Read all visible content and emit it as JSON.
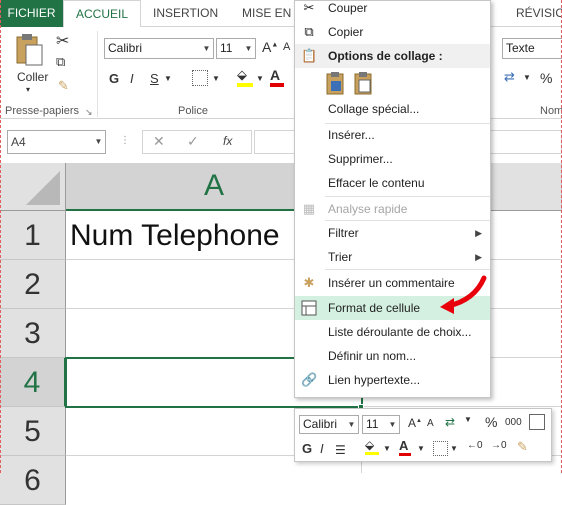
{
  "tabs": {
    "fichier": "FICHIER",
    "accueil": "ACCUEIL",
    "insertion": "INSERTION",
    "mise_en_page": "MISE EN P",
    "revision": "RÉVISION"
  },
  "ribbon": {
    "paste_label": "Coller",
    "clipboard_group": "Presse-papiers",
    "font_group": "Police",
    "number_group": "Nom",
    "font_name": "Calibri",
    "font_size": "11",
    "bold": "G",
    "italic": "I",
    "underline": "S",
    "number_format": "Texte",
    "percent": "%"
  },
  "formula_bar": {
    "name_box": "A4",
    "fx": "fx"
  },
  "sheet": {
    "column_a": "A",
    "rows": [
      "1",
      "2",
      "3",
      "4",
      "5",
      "6"
    ],
    "cell_a1": "Num Telephone",
    "selected_cell": "A4"
  },
  "context_menu": {
    "couper": "Couper",
    "copier": "Copier",
    "options_collage": "Options de collage :",
    "collage_special": "Collage spécial...",
    "inserer": "Insérer...",
    "supprimer": "Supprimer...",
    "effacer": "Effacer le contenu",
    "analyse": "Analyse rapide",
    "filtrer": "Filtrer",
    "trier": "Trier",
    "commentaire": "Insérer un commentaire",
    "format_cellule": "Format de cellule",
    "liste_deroulante": "Liste déroulante de choix...",
    "definir_nom": "Définir un nom...",
    "lien": "Lien hypertexte..."
  },
  "mini_toolbar": {
    "font_name": "Calibri",
    "font_size": "11",
    "bold": "G",
    "italic": "I",
    "percent": "%",
    "thousands": "000"
  },
  "colors": {
    "excel_green": "#217346",
    "highlight": "#d3f0e0",
    "annotation_arrow": "#e8000b"
  }
}
